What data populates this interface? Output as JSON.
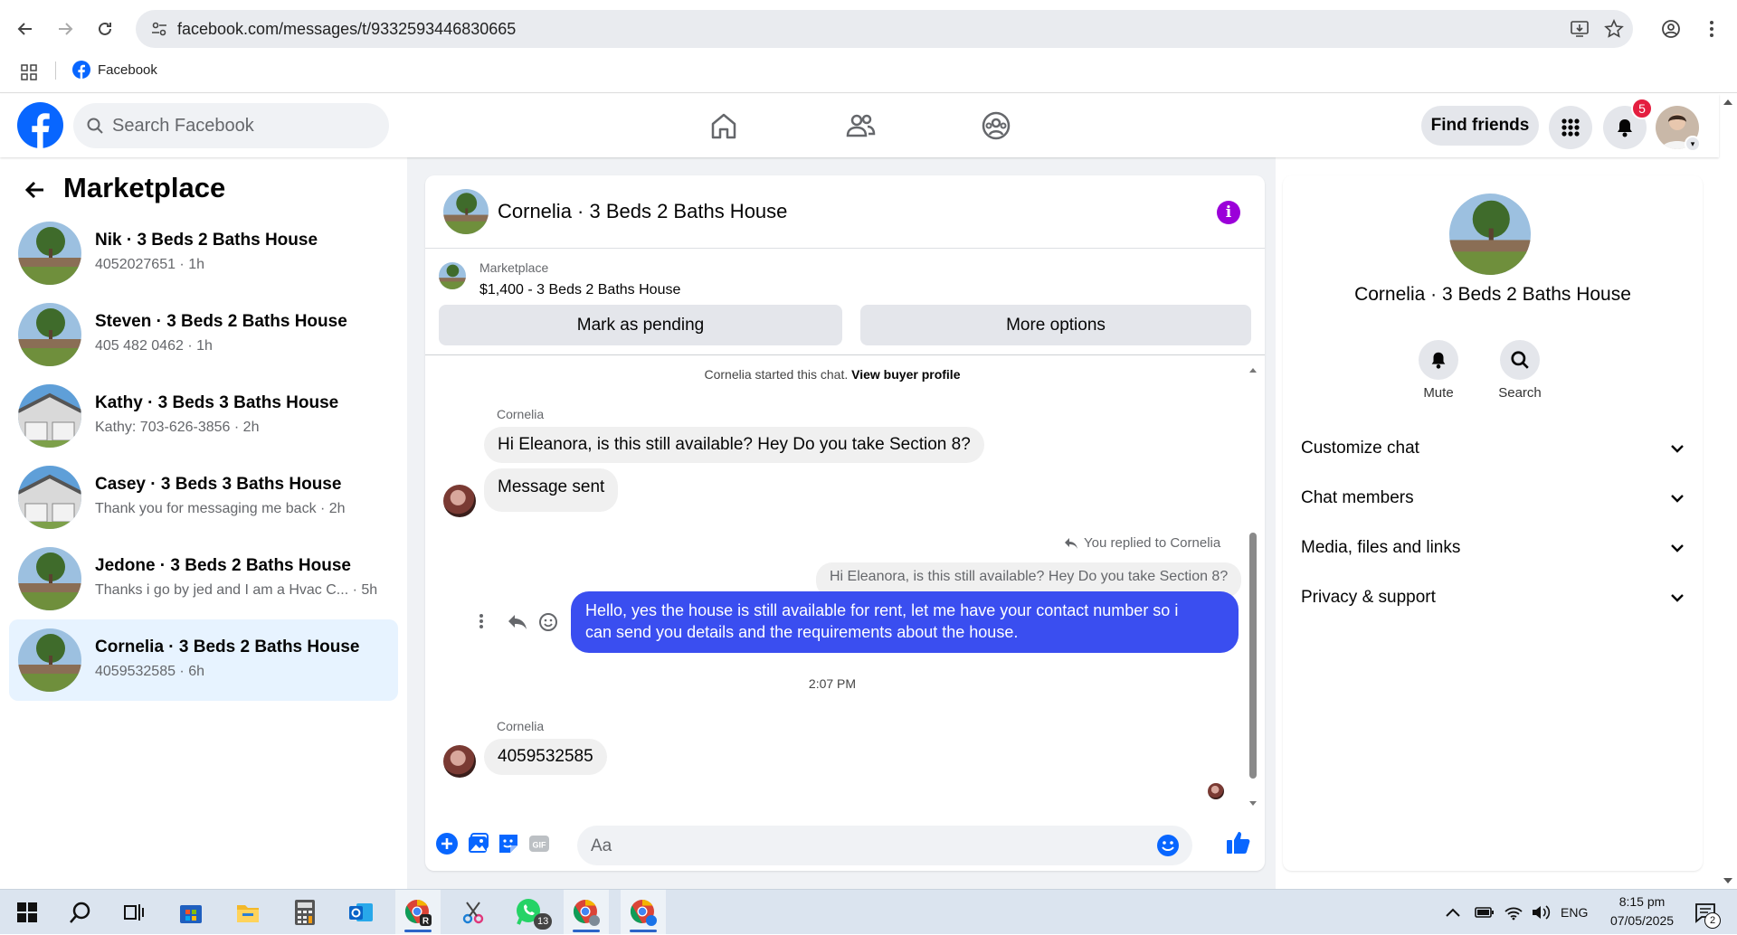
{
  "browser": {
    "url": "facebook.com/messages/t/9332593446830665",
    "bookmark_label": "Facebook"
  },
  "topbar": {
    "search_placeholder": "Search Facebook",
    "find_friends": "Find friends",
    "notification_count": "5"
  },
  "sidebar": {
    "title": "Marketplace",
    "conversations": [
      {
        "name": "Nik · 3 Beds 2 Baths House",
        "sub": "4052027651 · 1h"
      },
      {
        "name": "Steven · 3 Beds 2 Baths House",
        "sub": "405 482 0462 · 1h"
      },
      {
        "name": "Kathy · 3 Beds 3 Baths House",
        "sub": "Kathy: 703-626-3856 · 2h"
      },
      {
        "name": "Casey · 3 Beds 3 Baths House",
        "sub": "Thank you for messaging me back · 2h"
      },
      {
        "name": "Jedone · 3 Beds 2 Baths House",
        "sub": "Thanks i go by jed and I am a Hvac C...  · 5h"
      },
      {
        "name": "Cornelia · 3 Beds 2 Baths House",
        "sub": "4059532585 · 6h"
      }
    ]
  },
  "chat": {
    "title": "Cornelia · 3 Beds 2 Baths House",
    "listing_label": "Marketplace",
    "listing_price": "$1,400 - 3 Beds 2 Baths House",
    "mark_pending": "Mark as pending",
    "more_options": "More options",
    "started_text": "Cornelia started this chat.",
    "view_profile": "View buyer profile",
    "sender_name": "Cornelia",
    "msg1": "Hi Eleanora, is this still available? Hey Do you take Section 8?",
    "msg2": "Message sent",
    "replied_label": "You replied to Cornelia",
    "quoted_text": "Hi Eleanora, is this still available? Hey Do you take Section 8?",
    "reply_line1": "Hello, yes the house is still available for rent, let me have your contact number so i",
    "reply_line2": "can send you details and the requirements about the house.",
    "timestamp": "2:07 PM",
    "msg3": "4059532585",
    "composer_placeholder": "Aa"
  },
  "info_panel": {
    "name": "Cornelia · 3 Beds 2 Baths House",
    "mute": "Mute",
    "search": "Search",
    "rows": [
      "Customize chat",
      "Chat members",
      "Media, files and links",
      "Privacy & support"
    ]
  },
  "taskbar": {
    "whatsapp_badge": "13",
    "language": "ENG",
    "time": "8:15 pm",
    "date": "07/05/2025",
    "notif_badge": "2"
  },
  "colors": {
    "fb_blue": "#0866ff",
    "outgoing_bubble": "#3a4ef0",
    "info_purple": "#9b00d9",
    "active_conv": "#e7f3ff"
  }
}
